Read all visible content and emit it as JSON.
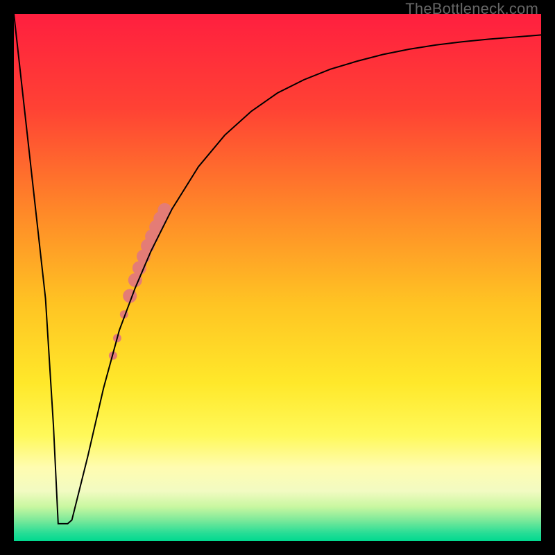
{
  "watermark_text": "TheBottleneck.com",
  "colors": {
    "background": "#000000",
    "gradient_stops": [
      {
        "offset": 0.0,
        "color": "#ff1f3f"
      },
      {
        "offset": 0.18,
        "color": "#ff4234"
      },
      {
        "offset": 0.38,
        "color": "#ff8a28"
      },
      {
        "offset": 0.55,
        "color": "#ffc423"
      },
      {
        "offset": 0.7,
        "color": "#ffe82a"
      },
      {
        "offset": 0.8,
        "color": "#fff95a"
      },
      {
        "offset": 0.86,
        "color": "#fffcb0"
      },
      {
        "offset": 0.905,
        "color": "#f2fbc2"
      },
      {
        "offset": 0.935,
        "color": "#c8f7a0"
      },
      {
        "offset": 0.96,
        "color": "#7de99a"
      },
      {
        "offset": 0.985,
        "color": "#26dd96"
      },
      {
        "offset": 1.0,
        "color": "#00d98f"
      }
    ],
    "curve_stroke": "#000000",
    "marker_fill": "#e47c76"
  },
  "chart_data": {
    "type": "line",
    "title": "",
    "xlabel": "",
    "ylabel": "",
    "xlim": [
      0,
      100
    ],
    "ylim": [
      0,
      100
    ],
    "series": [
      {
        "name": "bottleneck-curve",
        "x": [
          0,
          2,
          4,
          6,
          7.5,
          8.5,
          9.6,
          11,
          14,
          17,
          20,
          23,
          26,
          30,
          35,
          40,
          45,
          50,
          55,
          60,
          65,
          70,
          75,
          80,
          85,
          90,
          95,
          100
        ],
        "y": [
          100,
          82,
          64,
          46,
          22,
          4,
          3.5,
          4,
          16,
          29,
          40,
          48,
          55,
          63,
          71,
          77,
          81.5,
          85,
          87.5,
          89.5,
          91,
          92.3,
          93.3,
          94.1,
          94.7,
          95.2,
          95.6,
          96
        ]
      }
    ],
    "flat_bottom": {
      "x_start": 8.4,
      "x_end": 10.2,
      "y": 3.3
    },
    "markers": {
      "name": "highlight-points",
      "points": [
        {
          "x": 18.8,
          "y": 35.2
        },
        {
          "x": 19.6,
          "y": 38.5
        },
        {
          "x": 20.9,
          "y": 43.0
        },
        {
          "x": 22.0,
          "y": 46.5
        },
        {
          "x": 23.0,
          "y": 49.5
        },
        {
          "x": 23.8,
          "y": 51.8
        },
        {
          "x": 24.6,
          "y": 54.0
        },
        {
          "x": 25.4,
          "y": 56.0
        },
        {
          "x": 26.2,
          "y": 57.8
        },
        {
          "x": 27.0,
          "y": 59.6
        },
        {
          "x": 27.8,
          "y": 61.2
        },
        {
          "x": 28.6,
          "y": 62.8
        }
      ],
      "radius_map": [
        6,
        6,
        6,
        10,
        10,
        10,
        10,
        10,
        10,
        10,
        10,
        10
      ]
    }
  }
}
